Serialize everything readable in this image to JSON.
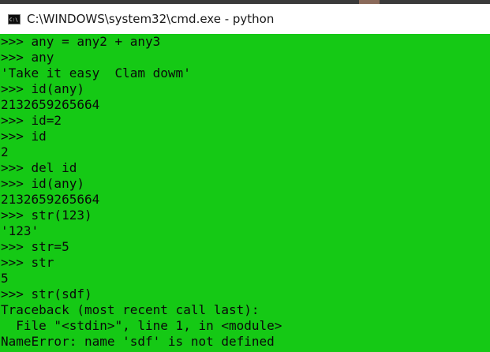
{
  "window": {
    "title": "C:\\WINDOWS\\system32\\cmd.exe - python",
    "icon": "cmd-icon"
  },
  "console": {
    "background": "#15c915",
    "foreground": "#0a0a0a",
    "lines": [
      ">>> any = any2 + any3",
      ">>> any",
      "'Take it easy  Clam dowm'",
      ">>> id(any)",
      "2132659265664",
      ">>> id=2",
      ">>> id",
      "2",
      ">>> del id",
      ">>> id(any)",
      "2132659265664",
      ">>> str(123)",
      "'123'",
      ">>> str=5",
      ">>> str",
      "5",
      ">>> str(sdf)",
      "Traceback (most recent call last):",
      "  File \"<stdin>\", line 1, in <module>",
      "NameError: name 'sdf' is not defined"
    ]
  }
}
